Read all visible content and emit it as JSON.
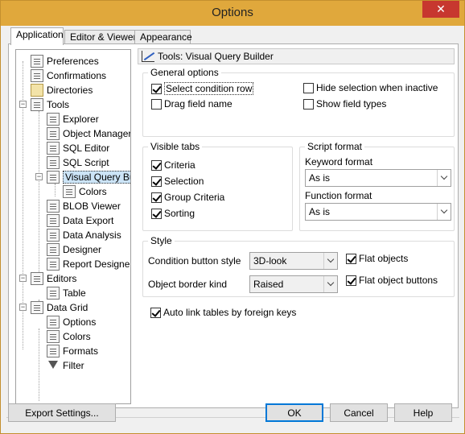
{
  "window": {
    "title": "Options",
    "close_glyph": "✕"
  },
  "tabs": [
    {
      "label": "Application"
    },
    {
      "label": "Editor & Viewers"
    },
    {
      "label": "Appearance"
    }
  ],
  "tree": [
    {
      "label": "Preferences",
      "icon": "preferences-icon"
    },
    {
      "label": "Confirmations",
      "icon": "confirmations-icon"
    },
    {
      "label": "Directories",
      "icon": "directories-icon"
    },
    {
      "label": "Tools",
      "icon": "tools-icon"
    },
    {
      "label": "Explorer",
      "icon": "explorer-icon"
    },
    {
      "label": "Object Manager",
      "icon": "object-manager-icon"
    },
    {
      "label": "SQL Editor",
      "icon": "sql-editor-icon"
    },
    {
      "label": "SQL Script",
      "icon": "sql-script-icon"
    },
    {
      "label": "Visual Query Buil",
      "icon": "visual-query-builder-icon"
    },
    {
      "label": "Colors",
      "icon": "colors-icon"
    },
    {
      "label": "BLOB Viewer",
      "icon": "blob-viewer-icon"
    },
    {
      "label": "Data Export",
      "icon": "data-export-icon"
    },
    {
      "label": "Data Analysis",
      "icon": "data-analysis-icon"
    },
    {
      "label": "Designer",
      "icon": "designer-icon"
    },
    {
      "label": "Report Designer",
      "icon": "report-designer-icon"
    },
    {
      "label": "Editors",
      "icon": "editors-icon"
    },
    {
      "label": "Table",
      "icon": "table-icon"
    },
    {
      "label": "Data Grid",
      "icon": "data-grid-icon"
    },
    {
      "label": "Options",
      "icon": "options-icon"
    },
    {
      "label": "Colors",
      "icon": "grid-colors-icon"
    },
    {
      "label": "Formats",
      "icon": "formats-icon"
    },
    {
      "label": "Filter",
      "icon": "filter-icon"
    }
  ],
  "panel": {
    "header": "Tools: Visual Query Builder",
    "general_options": {
      "title": "General options",
      "select_condition_row": "Select condition row",
      "drag_field_name": "Drag field name",
      "hide_selection": "Hide selection when inactive",
      "show_field_types": "Show field types"
    },
    "visible_tabs": {
      "title": "Visible tabs",
      "criteria": "Criteria",
      "selection": "Selection",
      "group_criteria": "Group Criteria",
      "sorting": "Sorting"
    },
    "script_format": {
      "title": "Script format",
      "keyword_label": "Keyword format",
      "keyword_value": "As is",
      "function_label": "Function format",
      "function_value": "As is"
    },
    "style": {
      "title": "Style",
      "condition_button_label": "Condition button style",
      "condition_button_value": "3D-look",
      "border_kind_label": "Object border kind",
      "border_kind_value": "Raised",
      "flat_objects": "Flat objects",
      "flat_object_buttons": "Flat object buttons"
    },
    "auto_link": "Auto link tables by foreign keys"
  },
  "buttons": {
    "export": "Export Settings...",
    "ok": "OK",
    "cancel": "Cancel",
    "help": "Help"
  }
}
